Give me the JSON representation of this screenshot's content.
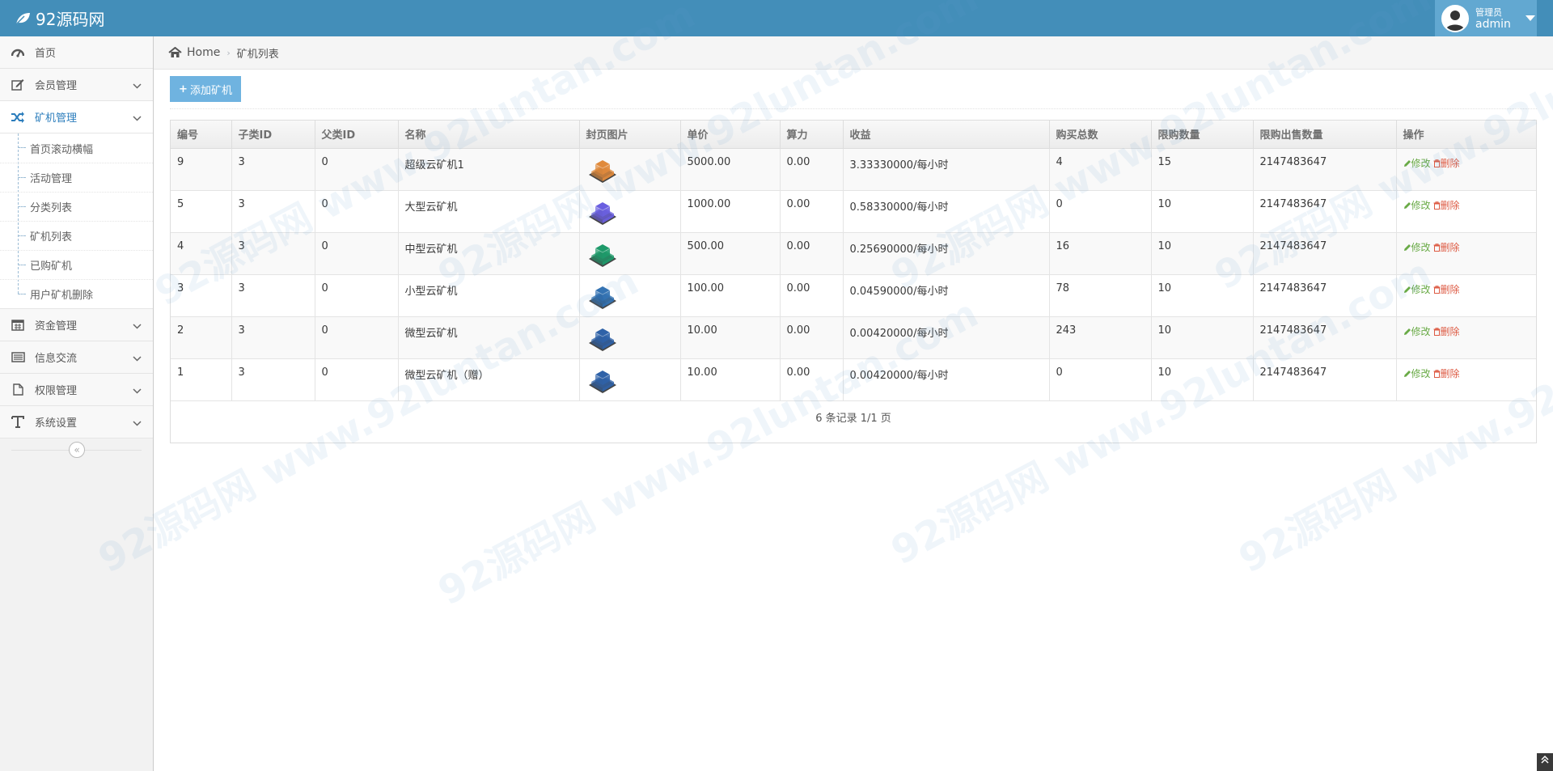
{
  "navbar": {
    "brand": "92源码网",
    "user_role": "管理员",
    "user_name": "admin"
  },
  "sidebar": {
    "items": [
      {
        "label": "首页",
        "icon": "dashboard-icon"
      },
      {
        "label": "会员管理",
        "icon": "edit-icon"
      },
      {
        "label": "矿机管理",
        "icon": "shuffle-icon"
      },
      {
        "label": "资金管理",
        "icon": "calendar-icon"
      },
      {
        "label": "信息交流",
        "icon": "list-icon"
      },
      {
        "label": "权限管理",
        "icon": "file-icon"
      },
      {
        "label": "系统设置",
        "icon": "text-icon"
      }
    ],
    "sub_items": [
      "首页滚动横幅",
      "活动管理",
      "分类列表",
      "矿机列表",
      "已购矿机",
      "用户矿机删除"
    ],
    "collapse_label": "«"
  },
  "breadcrumb": {
    "home": "Home",
    "current": "矿机列表"
  },
  "toolbar": {
    "add_label": "添加矿机"
  },
  "table": {
    "headers": [
      "编号",
      "子类ID",
      "父类ID",
      "名称",
      "封页图片",
      "单价",
      "算力",
      "收益",
      "购买总数",
      "限购数量",
      "限购出售数量",
      "操作"
    ],
    "rows": [
      {
        "id": "9",
        "sub": "3",
        "parent": "0",
        "name": "超级云矿机1",
        "img_color": "#e08a3c",
        "price": "5000.00",
        "power": "0.00",
        "income": "3.33330000/每小时",
        "bought": "4",
        "limit": "15",
        "sell_limit": "2147483647"
      },
      {
        "id": "5",
        "sub": "3",
        "parent": "0",
        "name": "大型云矿机",
        "img_color": "#6a5fe0",
        "price": "1000.00",
        "power": "0.00",
        "income": "0.58330000/每小时",
        "bought": "0",
        "limit": "10",
        "sell_limit": "2147483647"
      },
      {
        "id": "4",
        "sub": "3",
        "parent": "0",
        "name": "中型云矿机",
        "img_color": "#1e9a6a",
        "price": "500.00",
        "power": "0.00",
        "income": "0.25690000/每小时",
        "bought": "16",
        "limit": "10",
        "sell_limit": "2147483647"
      },
      {
        "id": "3",
        "sub": "3",
        "parent": "0",
        "name": "小型云矿机",
        "img_color": "#2f6fb0",
        "price": "100.00",
        "power": "0.00",
        "income": "0.04590000/每小时",
        "bought": "78",
        "limit": "10",
        "sell_limit": "2147483647"
      },
      {
        "id": "2",
        "sub": "3",
        "parent": "0",
        "name": "微型云矿机",
        "img_color": "#2f62a8",
        "price": "10.00",
        "power": "0.00",
        "income": "0.00420000/每小时",
        "bought": "243",
        "limit": "10",
        "sell_limit": "2147483647"
      },
      {
        "id": "1",
        "sub": "3",
        "parent": "0",
        "name": "微型云矿机（赠）",
        "img_color": "#2f62a8",
        "price": "10.00",
        "power": "0.00",
        "income": "0.00420000/每小时",
        "bought": "0",
        "limit": "10",
        "sell_limit": "2147483647"
      }
    ],
    "edit_label": "修改",
    "delete_label": "删除"
  },
  "pager": {
    "text": "6 条记录 1/1 页"
  },
  "watermark": "92源码网 www.92luntan.com"
}
